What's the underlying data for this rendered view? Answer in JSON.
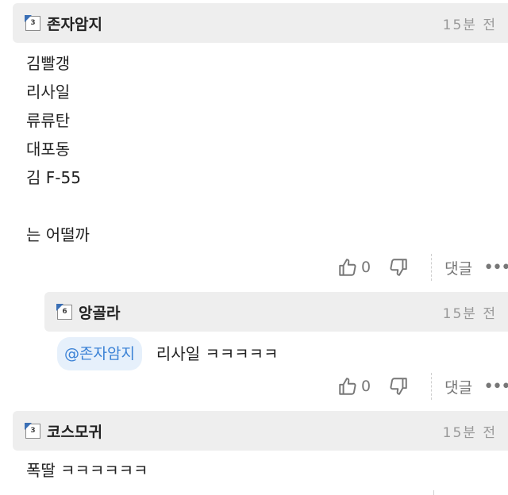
{
  "comments": [
    {
      "level": "3",
      "author": "존자암지",
      "time": "15분 전",
      "lines": [
        "김빨갱",
        "리사일",
        "류류탄",
        "대포동",
        "김 F-55",
        "",
        "는 어떨까"
      ],
      "likes": "0",
      "reply_label": "댓글",
      "more": "•••"
    },
    {
      "level": "6",
      "author": "앙골라",
      "time": "15분 전",
      "mention": "@존자암지",
      "text": "리사일 ㅋㅋㅋㅋㅋ",
      "likes": "0",
      "reply_label": "댓글",
      "more": "•••"
    },
    {
      "level": "3",
      "author": "코스모귀",
      "time": "15분 전",
      "text": "폭딸 ㅋㅋㅋㅋㅋㅋ"
    }
  ],
  "colors": {
    "header_bg": "#eeeeee",
    "mention_bg": "#e6f0fb",
    "mention_text": "#3b82d6",
    "muted": "#777777"
  }
}
